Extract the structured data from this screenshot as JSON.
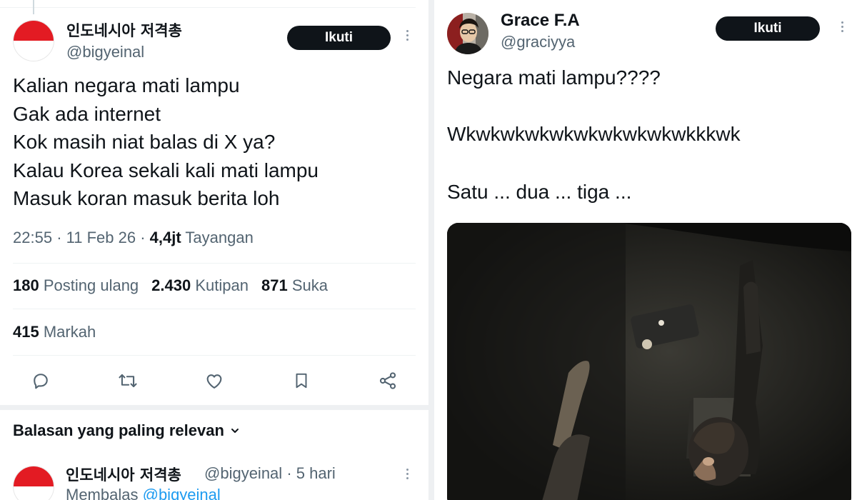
{
  "left_tweet": {
    "author_name": "인도네시아 저격총",
    "author_handle": "@bigyeinal",
    "follow_label": "Ikuti",
    "text_lines": [
      "Kalian negara mati lampu",
      "Gak ada internet",
      "Kok masih niat balas di X ya?",
      "Kalau Korea sekali kali mati lampu",
      "Masuk koran masuk berita loh"
    ],
    "time": "22:55",
    "date": "11 Feb 26",
    "views_count": "4,4jt",
    "views_label": "Tayangan",
    "stats": {
      "reposts_count": "180",
      "reposts_label": "Posting ulang",
      "quotes_count": "2.430",
      "quotes_label": "Kutipan",
      "likes_count": "871",
      "likes_label": "Suka",
      "bookmarks_count": "415",
      "bookmarks_label": "Markah"
    },
    "actions": [
      "reply-icon",
      "repost-icon",
      "like-icon",
      "bookmark-icon",
      "share-icon"
    ],
    "replies_sort_label": "Balasan yang paling relevan",
    "reply": {
      "author_name": "인도네시아 저격총",
      "author_handle": "@bigyeinal",
      "age": "5 hari",
      "replying_prefix": "Membalas",
      "replying_to": "@bigyeinal"
    }
  },
  "right_tweet": {
    "author_name": "Grace F.A",
    "author_handle": "@graciyya",
    "follow_label": "Ikuti",
    "text_lines": [
      "Negara mati lampu????",
      "Wkwkwkwkwkwkwkwkwkwkkkwk",
      "Satu ... dua ... tiga ..."
    ]
  },
  "colors": {
    "flag_red": "#e31b23",
    "button_black": "#0f1419",
    "link_blue": "#1d9bf0",
    "secondary_text": "#536471"
  }
}
